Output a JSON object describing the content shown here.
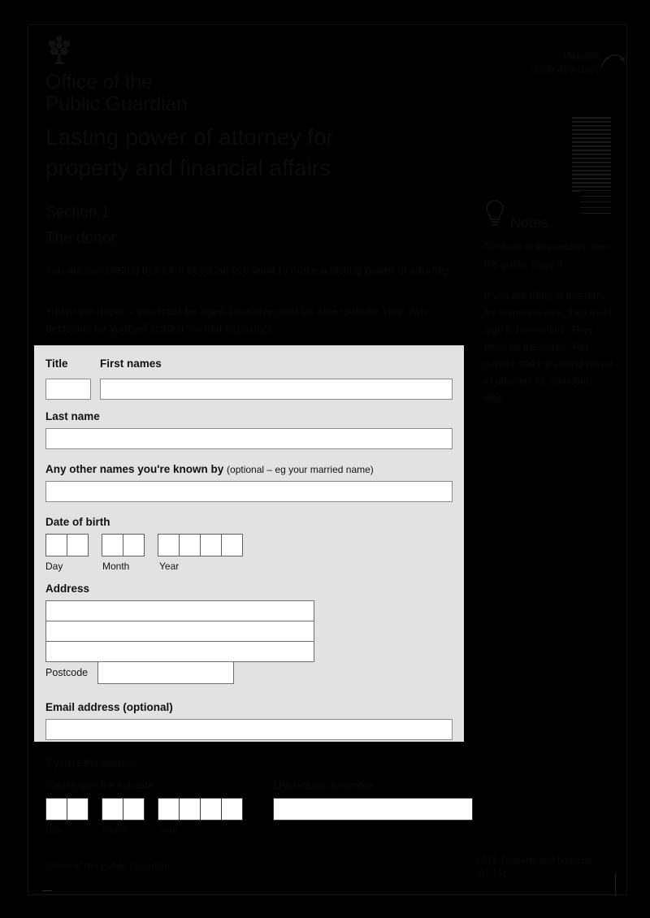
{
  "organisation": {
    "name_line1": "Office of the",
    "name_line2": "Public Guardian",
    "crest_icon": "royal-crest-icon"
  },
  "helpline": {
    "label": "Helpline",
    "number": "0300 456 0300",
    "arrow_icon": "curved-arrow-icon"
  },
  "document": {
    "title_line1": "Lasting power of attorney for",
    "title_line2": "property and financial affairs",
    "section_number": "Section 1",
    "section_name": "The donor",
    "intro_paragraph_1": "You are completing this form because you want to make a lasting power of attorney.",
    "intro_paragraph_2": "You're the donor – you must be aged 18 or over and be able to make your own decisions for yourself (called 'mental capacity')."
  },
  "notes": {
    "icon": "lightbulb-icon",
    "title": "Notes",
    "paragraph_1": "For help in this section, see the guide, page 4",
    "paragraph_2": "If you are filling in this form for someone else, they must sign it themselves. They must be the donor. You cannot make a lasting power of attorney for someone else."
  },
  "form": {
    "title_label": "Title",
    "first_names_label": "First names",
    "last_name_label": "Last name",
    "other_names_label": "Any other names you're known by",
    "other_names_optional": "(optional – eg your married name)",
    "date_of_birth_label": "Date of birth",
    "day_caption": "Day",
    "month_caption": "Month",
    "year_caption": "Year",
    "address_label": "Address",
    "postcode_label": "Postcode",
    "email_label": "Email address (optional)",
    "title_value": "",
    "first_names_value": "",
    "last_name_value": "",
    "other_names_value": "",
    "address_line_1": "",
    "address_line_2": "",
    "address_line_3": "",
    "postcode_value": "",
    "email_value": ""
  },
  "bottom": {
    "note": "If you're the attorney",
    "date_label": "Please give the full date",
    "lpa_ref_label": "LPA reference number",
    "day_caption": "Day",
    "month_caption": "Month",
    "year_caption": "Year",
    "lpa_ref_value": ""
  },
  "footer": {
    "left": "Office of the Public Guardian",
    "right_line1": "LP1F Property and financial",
    "right_line2": "(07.15)"
  },
  "colors": {
    "page_background": "#000000",
    "card_background": "#e2e2e2",
    "input_background": "#ffffff",
    "input_border": "#8a8a8a",
    "text": "#0b0b0b"
  }
}
